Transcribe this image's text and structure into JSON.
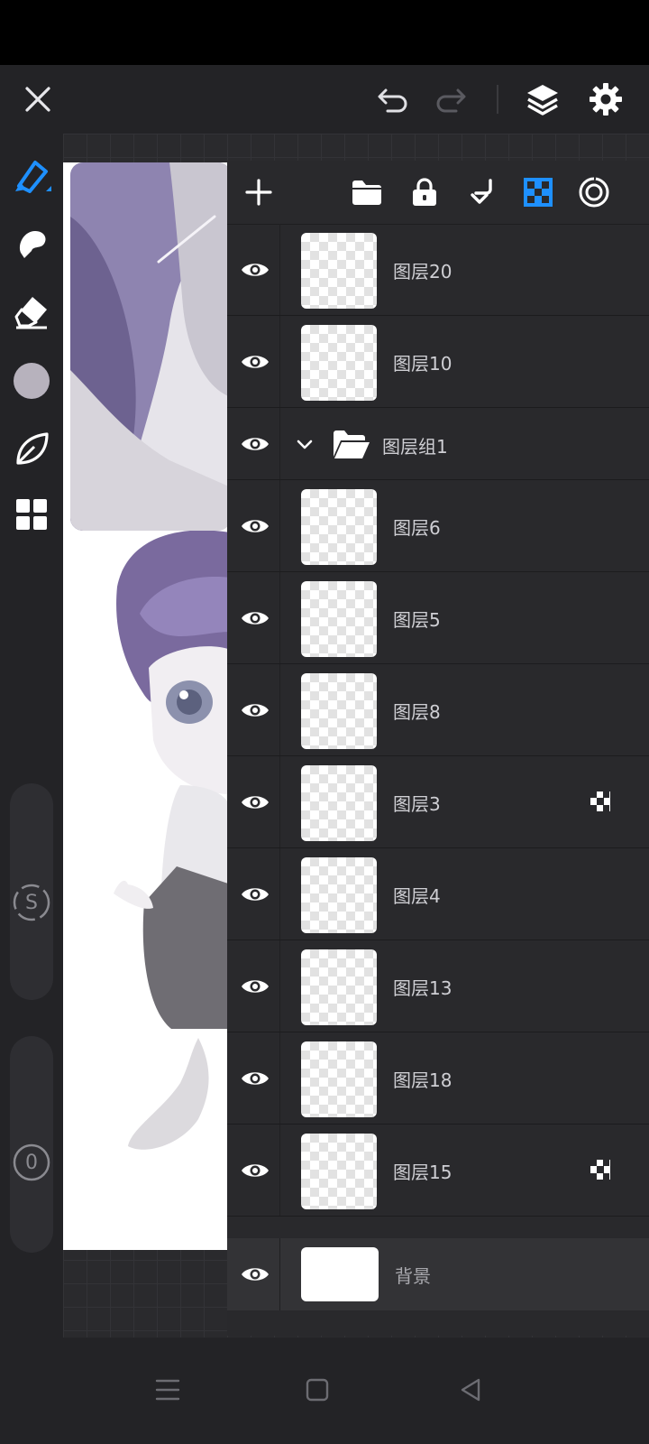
{
  "toolbar": {
    "close_icon": "close-icon",
    "undo_icon": "undo-icon",
    "redo_icon": "redo-icon",
    "layers_icon": "layers-icon",
    "settings_icon": "gear-icon"
  },
  "colors": {
    "accent": "#1e90ff",
    "background": "#232326",
    "panel": "#29292c",
    "current_brush_color": "#b7b2bd"
  },
  "left_tools": {
    "items": [
      "brush-tool",
      "smudge-tool",
      "eraser-tool",
      "color-swatch",
      "leaf-tool",
      "gallery-tool"
    ],
    "size_slider_label": "S",
    "opacity_slider_label": "0"
  },
  "layers": {
    "toolbar": [
      "add-layer",
      "add-group",
      "lock",
      "merge-down",
      "alpha-lock",
      "blend-mode"
    ],
    "items": [
      {
        "name": "图层20",
        "mask": false
      },
      {
        "name": "图层10",
        "mask": false
      }
    ],
    "group": {
      "name": "图层组1",
      "expanded": true
    },
    "group_items": [
      {
        "name": "图层6",
        "mask": false
      },
      {
        "name": "图层5",
        "mask": false
      },
      {
        "name": "图层8",
        "mask": false
      },
      {
        "name": "图层3",
        "mask": true
      },
      {
        "name": "图层4",
        "mask": false
      },
      {
        "name": "图层13",
        "mask": false
      },
      {
        "name": "图层18",
        "mask": false
      },
      {
        "name": "图层15",
        "mask": true
      }
    ],
    "background": {
      "name": "背景"
    }
  },
  "nav": {
    "menu_icon": "menu-icon",
    "home_icon": "home-icon",
    "back_icon": "back-icon"
  }
}
